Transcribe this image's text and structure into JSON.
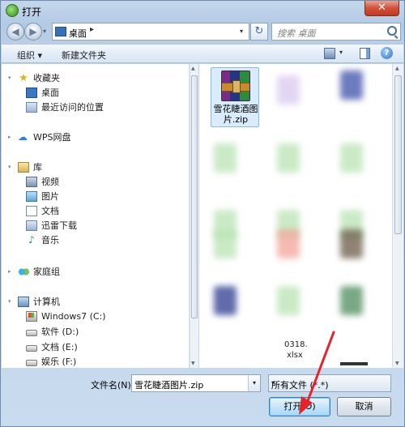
{
  "window": {
    "title": "打开",
    "close_label": "✕"
  },
  "address": {
    "back": "◀",
    "forward": "▶",
    "dropdown": "▾",
    "path": "桌面",
    "separator": "▸",
    "path_dropdown": "▾",
    "refresh": "↻",
    "search_placeholder": "搜索 桌面"
  },
  "toolbar": {
    "organize": "组织 ▾",
    "new_folder": "新建文件夹",
    "view_dropdown": "▾",
    "help": "?"
  },
  "nav": {
    "expander": "▸",
    "expander_open": "▾",
    "favorites": "收藏夹",
    "favorite_items": [
      "桌面",
      "最近访问的位置"
    ],
    "wps": "WPS网盘",
    "libraries": "库",
    "library_items": [
      "视频",
      "图片",
      "文档",
      "迅雷下载",
      "音乐"
    ],
    "homegroup": "家庭组",
    "computer": "计算机",
    "drives": [
      "Windows7 (C:)",
      "软件 (D:)",
      "文档 (E:)",
      "娱乐 (F:)"
    ]
  },
  "files": {
    "selected_name": "雪花睫酒图片.zip",
    "visible_captions": [
      "0318.",
      "xlsx"
    ]
  },
  "bottom": {
    "filename_label": "文件名(N):",
    "filename_value": "雪花睫酒图片.zip",
    "filename_drop": "▾",
    "filetype_value": "所有文件 (*.*)",
    "filetype_drop": "▾",
    "open_label": "打开(O)",
    "cancel_label": "取消"
  },
  "colors": {
    "annotation_arrow": "#e5232a",
    "selection": "#d8ecfc"
  }
}
